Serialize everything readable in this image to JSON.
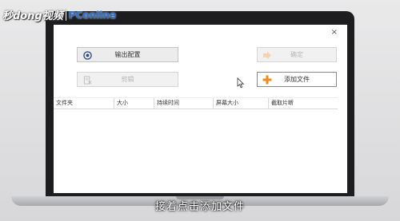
{
  "watermark": {
    "brand_cn": "秒dong视频",
    "brand_en": "PConline"
  },
  "window": {
    "close_glyph": "×"
  },
  "buttons": {
    "output_config": "输出配置",
    "confirm": "确定",
    "cut": "剪辑",
    "add_file": "添加文件"
  },
  "table": {
    "columns": [
      "文件夹",
      "大小",
      "持续时间",
      "屏幕大小",
      "截取片断"
    ]
  },
  "caption": "接着点击添加文件",
  "colors": {
    "accent_orange": "#f08a1c",
    "disabled_text": "#b7b7b7"
  }
}
